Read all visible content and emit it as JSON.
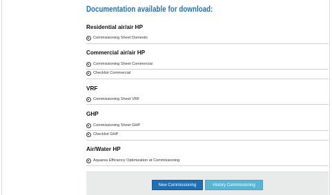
{
  "documentation": {
    "title": "Documentation available for download:",
    "sections": [
      {
        "heading": "Residential air/air HP",
        "links": [
          "Commissioning Sheet Domestic"
        ]
      },
      {
        "heading": "Commercial air/air HP",
        "links": [
          "Commissioning Sheet Commercial",
          "Checklist Commercial"
        ]
      },
      {
        "heading": "VRF",
        "links": [
          "Commissioning Sheet VRF"
        ]
      },
      {
        "heading": "GHP",
        "links": [
          "Commissioning Sheet GHP",
          "Checklist GHP"
        ]
      },
      {
        "heading": "Air/Water HP",
        "links": [
          "Aquarea Efficiency Optimization at Commissioning"
        ]
      }
    ]
  },
  "footer": {
    "new_commissioning_label": "New Commissioning",
    "history_commissioning_label": "History Commissioning"
  },
  "icons": {
    "download": "download-circle-icon"
  },
  "colors": {
    "title_blue": "#1f70b8",
    "primary_button": "#1f6fb4",
    "secondary_button": "#58b6d4",
    "footer_bg": "#e9eaea"
  }
}
